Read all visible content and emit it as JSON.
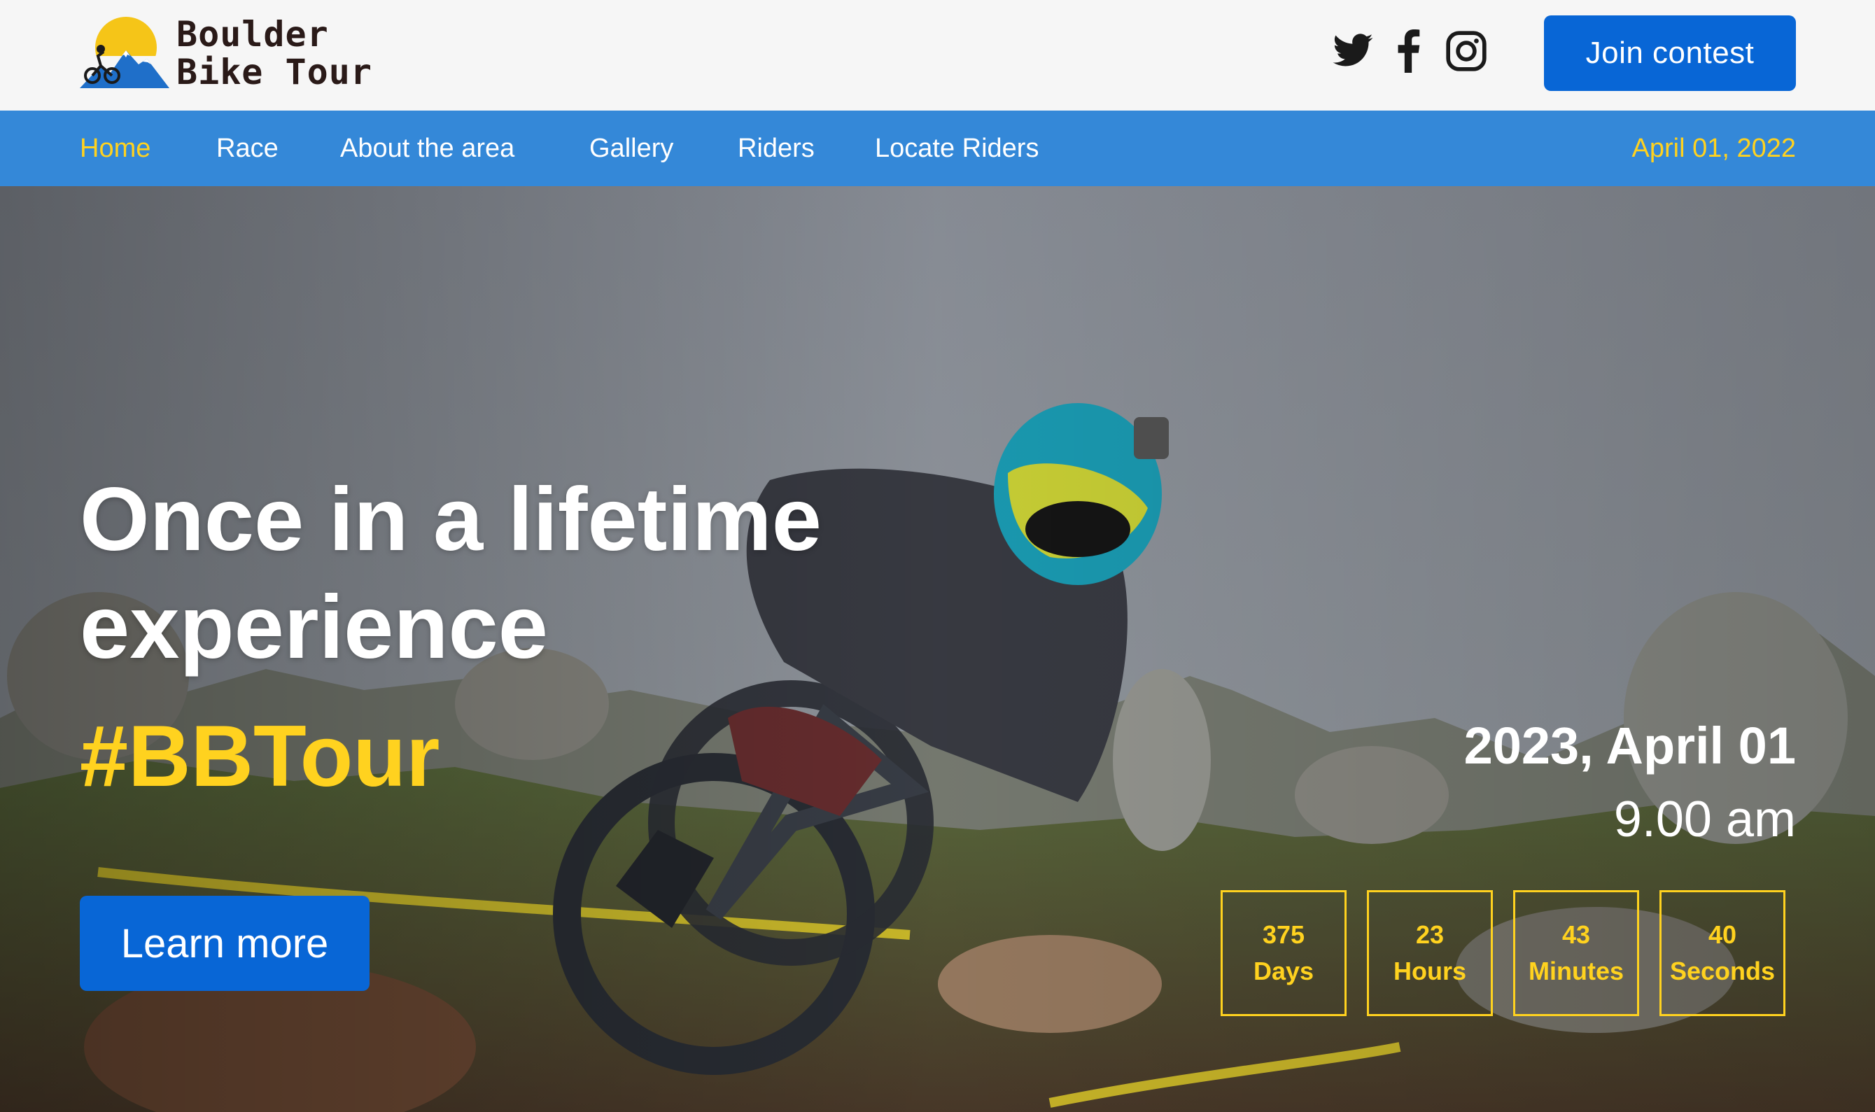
{
  "brand": {
    "line1": "Boulder",
    "line2": "Bike Tour",
    "sun_color": "#f5c518",
    "mountain_color": "#1f6fc9"
  },
  "social": [
    {
      "name": "twitter-icon"
    },
    {
      "name": "facebook-icon"
    },
    {
      "name": "instagram-icon"
    }
  ],
  "header": {
    "join_label": "Join contest"
  },
  "nav": {
    "items": [
      {
        "label": "Home",
        "active": true
      },
      {
        "label": "Race"
      },
      {
        "label": "About the area"
      },
      {
        "label": "Gallery"
      },
      {
        "label": "Riders"
      },
      {
        "label": "Locate Riders"
      }
    ],
    "date": "April 01, 2022"
  },
  "hero": {
    "headline_line1": "Once in a lifetime",
    "headline_line2": "experience",
    "hashtag": "#BBTour",
    "cta_label": "Learn more",
    "event_date": "2023, April 01",
    "event_time": "9.00 am",
    "countdown": [
      {
        "value": "375",
        "unit": "Days"
      },
      {
        "value": "23",
        "unit": "Hours"
      },
      {
        "value": "43",
        "unit": "Minutes"
      },
      {
        "value": "40",
        "unit": "Seconds"
      }
    ]
  },
  "colors": {
    "accent_blue": "#0866d6",
    "nav_blue": "#3488d8",
    "highlight_yellow": "#ffd21f"
  }
}
